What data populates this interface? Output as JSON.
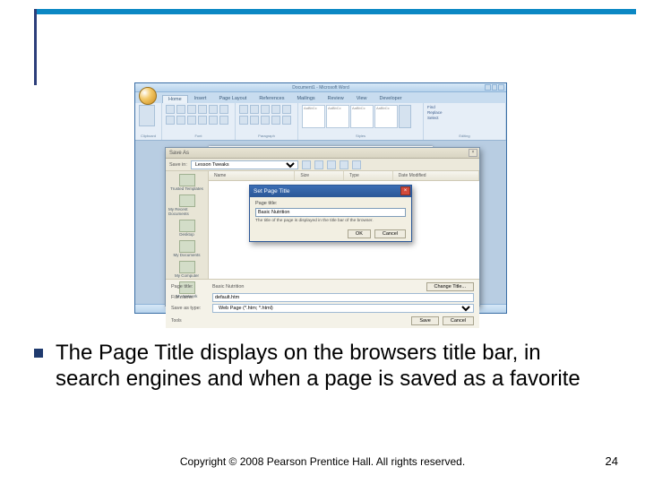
{
  "decor": {},
  "word": {
    "title": "Document1 - Microsoft Word",
    "tabs": [
      "Home",
      "Insert",
      "Page Layout",
      "References",
      "Mailings",
      "Review",
      "View",
      "Developer"
    ],
    "groups": [
      "Clipboard",
      "Font",
      "Paragraph",
      "Styles",
      "Editing"
    ],
    "style_samples": [
      "AaBbCc",
      "AaBbCc",
      "AaBbCc",
      "AaBbCc"
    ],
    "editing": [
      "Find",
      "Replace",
      "Select"
    ]
  },
  "saveas": {
    "title": "Save As",
    "lookin_label": "Save in:",
    "lookin_value": "Lesson Tweaks",
    "places": [
      "Trusted Templates",
      "My Recent Documents",
      "Desktop",
      "My Documents",
      "My Computer",
      "My Network"
    ],
    "columns": [
      "Name",
      "Size",
      "Type",
      "Date Modified"
    ],
    "filename_label": "File name:",
    "filename_value": "default.htm",
    "savetype_label": "Save as type:",
    "savetype_value": "Web Page (*.htm; *.html)",
    "pagetitle_label": "Page title:",
    "pagetitle_value": "Basic Nutrition",
    "change_title_btn": "Change Title...",
    "tools": "Tools",
    "save_btn": "Save",
    "cancel_btn": "Cancel"
  },
  "spt": {
    "title": "Set Page Title",
    "field_label": "Page title:",
    "field_value": "Basic Nutrition",
    "hint": "The title of the page is displayed in the title bar of the browser.",
    "ok": "OK",
    "cancel": "Cancel"
  },
  "bullet": "The Page Title displays on the browsers title bar, in search engines and when a page is saved as a favorite",
  "copyright": "Copyright © 2008 Pearson Prentice Hall. All rights reserved.",
  "pagenum": "24"
}
